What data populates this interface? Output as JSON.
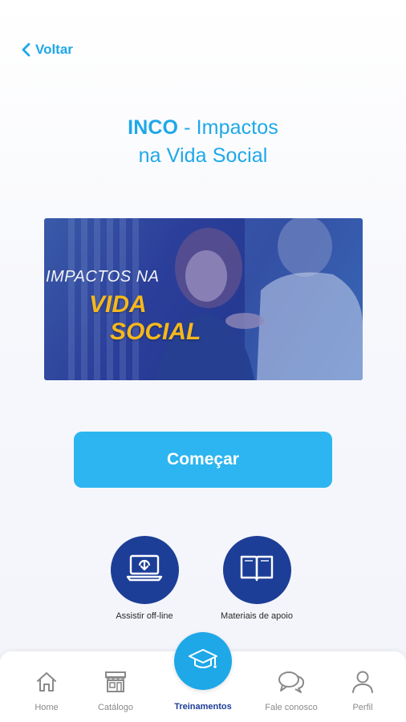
{
  "header": {
    "back_label": "Voltar"
  },
  "course": {
    "title_strong": "INCO",
    "title_rest_line1": " - Impactos",
    "title_line2": "na Vida Social",
    "banner": {
      "line1": "IMPACTOS NA",
      "line2": "VIDA",
      "line3": "SOCIAL"
    }
  },
  "start_button_label": "Começar",
  "actions": [
    {
      "label": "Assistir off-line",
      "icon": "laptop-download-icon"
    },
    {
      "label": "Materiais de apoio",
      "icon": "book-icon"
    }
  ],
  "bottom_nav": {
    "items": [
      {
        "label": "Home",
        "icon": "home-icon"
      },
      {
        "label": "Catálogo",
        "icon": "store-icon"
      },
      {
        "label": "Treinamentos",
        "icon": "graduation-cap-icon",
        "active": true
      },
      {
        "label": "Fale conosco",
        "icon": "chat-icon"
      },
      {
        "label": "Perfil",
        "icon": "user-icon"
      }
    ]
  },
  "colors": {
    "accent": "#1ea8e8",
    "button": "#2cb5f0",
    "navy": "#1d3e97",
    "banner_text_yellow": "#f5b81d",
    "inactive_nav": "#8a8a8a"
  }
}
